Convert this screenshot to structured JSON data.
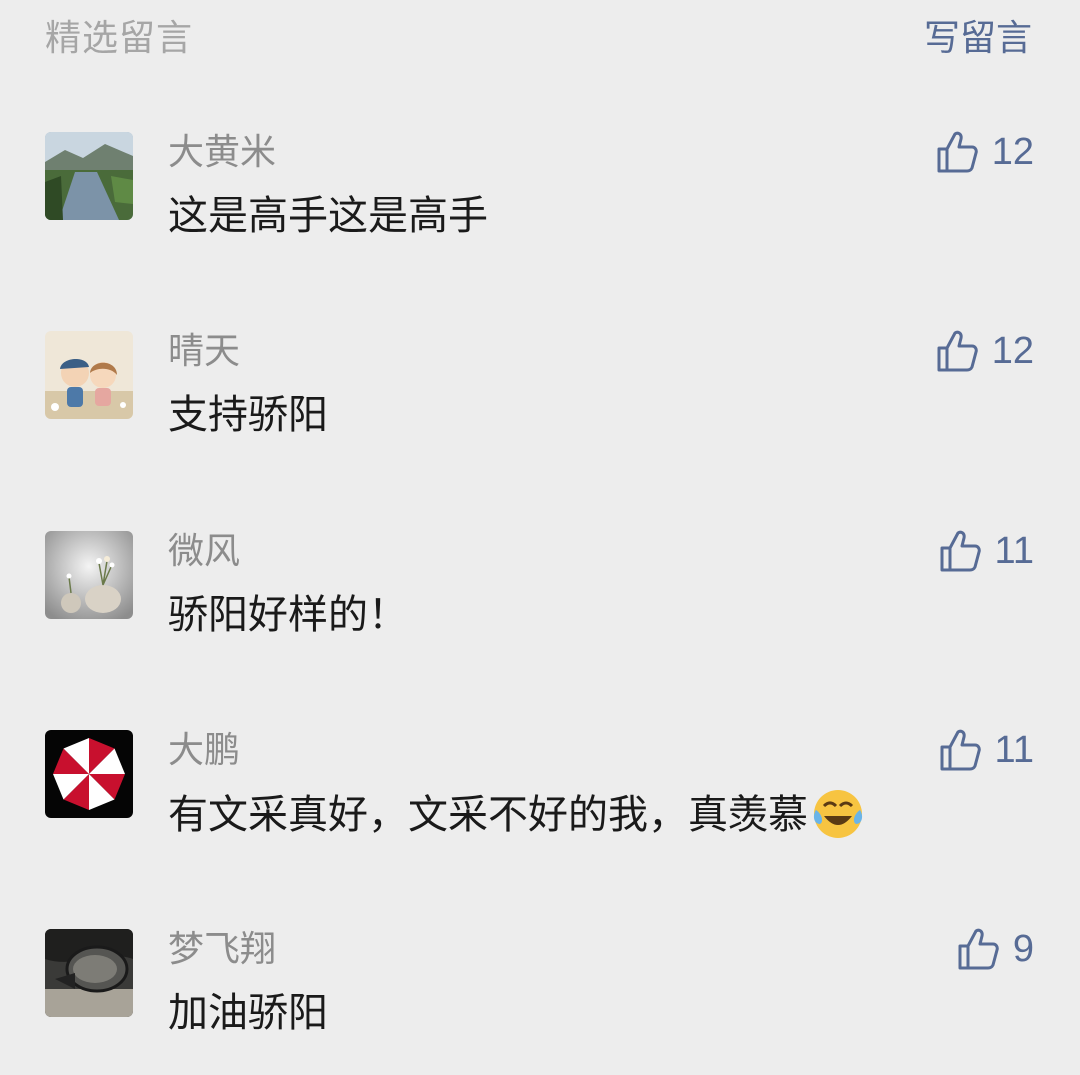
{
  "header": {
    "title": "精选留言",
    "write_label": "写留言"
  },
  "comments": [
    {
      "nickname": "大黄米",
      "content": "这是高手这是高手",
      "likes": "12"
    },
    {
      "nickname": "晴天",
      "content": "支持骄阳",
      "likes": "12"
    },
    {
      "nickname": "微风",
      "content": "骄阳好样的！",
      "likes": "11"
    },
    {
      "nickname": "大鹏",
      "content": "有文采真好，文采不好的我，真羡慕",
      "likes": "11",
      "emoji": "laughing-crying-emoji"
    },
    {
      "nickname": "梦飞翔",
      "content": "加油骄阳",
      "likes": "9"
    }
  ],
  "colors": {
    "link": "#576b95",
    "muted": "#a6a6a6",
    "nickname": "#8c8c8c",
    "text": "#1a1a1a",
    "background": "#ededed"
  }
}
